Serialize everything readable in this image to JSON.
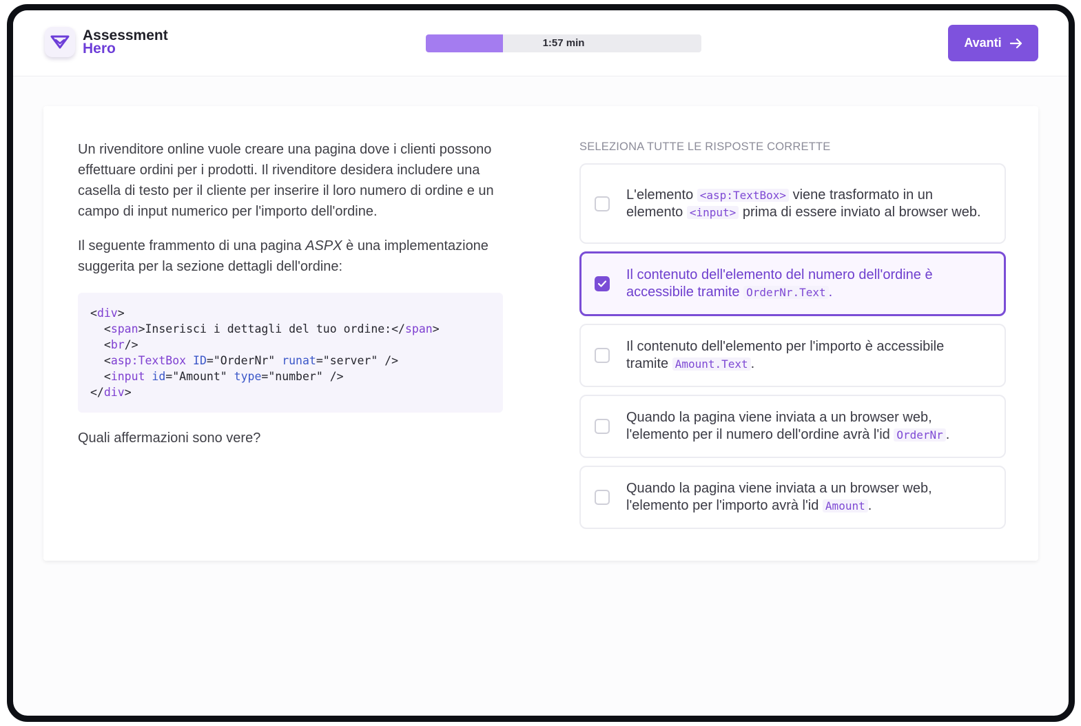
{
  "header": {
    "logo_line1": "Assessment",
    "logo_line2": "Hero",
    "timer_text": "1:57 min",
    "progress_fraction": 0.28,
    "next_label": "Avanti"
  },
  "question": {
    "paragraph1": "Un rivenditore online vuole creare una pagina dove i clienti possono effettuare ordini per i prodotti. Il rivenditore desidera includere una casella di testo per il cliente per inserire il loro numero di ordine e un campo di input numerico per l'importo dell'ordine.",
    "paragraph2_before": "Il seguente frammento di una pagina ",
    "paragraph2_em": "ASPX",
    "paragraph2_after": " è una implementazione suggerita per la sezione dettagli dell'ordine:",
    "code": {
      "line1_open": "<",
      "line1_tag": "div",
      "line1_close": ">",
      "line2_indent": "  <",
      "line2_tag1": "span",
      "line2_text": ">Inserisci i dettagli del tuo ordine:</",
      "line2_tag2": "span",
      "line2_close": ">",
      "line3_indent": "  <",
      "line3_tag": "br",
      "line3_close": "/>",
      "line4_indent": "  <",
      "line4_tag": "asp:TextBox",
      "line4_attr1": "ID",
      "line4_val1": "=\"OrderNr\" ",
      "line4_attr2": "runat",
      "line4_val2": "=\"server\" />",
      "line5_indent": "  <",
      "line5_tag": "input",
      "line5_attr1": "id",
      "line5_val1": "=\"Amount\" ",
      "line5_attr2": "type",
      "line5_val2": "=\"number\" />",
      "line6_open": "</",
      "line6_tag": "div",
      "line6_close": ">"
    },
    "prompt": "Quali affermazioni sono vere?"
  },
  "answers": {
    "instruction": "SELEZIONA TUTTE LE RISPOSTE CORRETTE",
    "options": [
      {
        "checked": false,
        "t1": "L'elemento ",
        "c1": "<asp:TextBox>",
        "t2": " viene trasformato in un elemento ",
        "c2": "<input>",
        "t3": " prima di essere inviato al browser web."
      },
      {
        "checked": true,
        "t1": "Il contenuto dell'elemento del numero dell'ordine è accessibile tramite ",
        "c1": "OrderNr.Text",
        "t2": "."
      },
      {
        "checked": false,
        "t1": "Il contenuto dell'elemento per l'importo è accessibile tramite ",
        "c1": "Amount.Text",
        "t2": "."
      },
      {
        "checked": false,
        "t1": "Quando la pagina viene inviata a un browser web, l'elemento per il numero dell'ordine avrà l'id ",
        "c1": "OrderNr",
        "t2": "."
      },
      {
        "checked": false,
        "t1": "Quando la pagina viene inviata a un browser web, l'elemento per l'importo avrà l'id ",
        "c1": "Amount",
        "t2": "."
      }
    ]
  },
  "colors": {
    "accent": "#7e52dd",
    "progress_fill": "#a47cf0",
    "selected_border": "#7a4dd6"
  }
}
